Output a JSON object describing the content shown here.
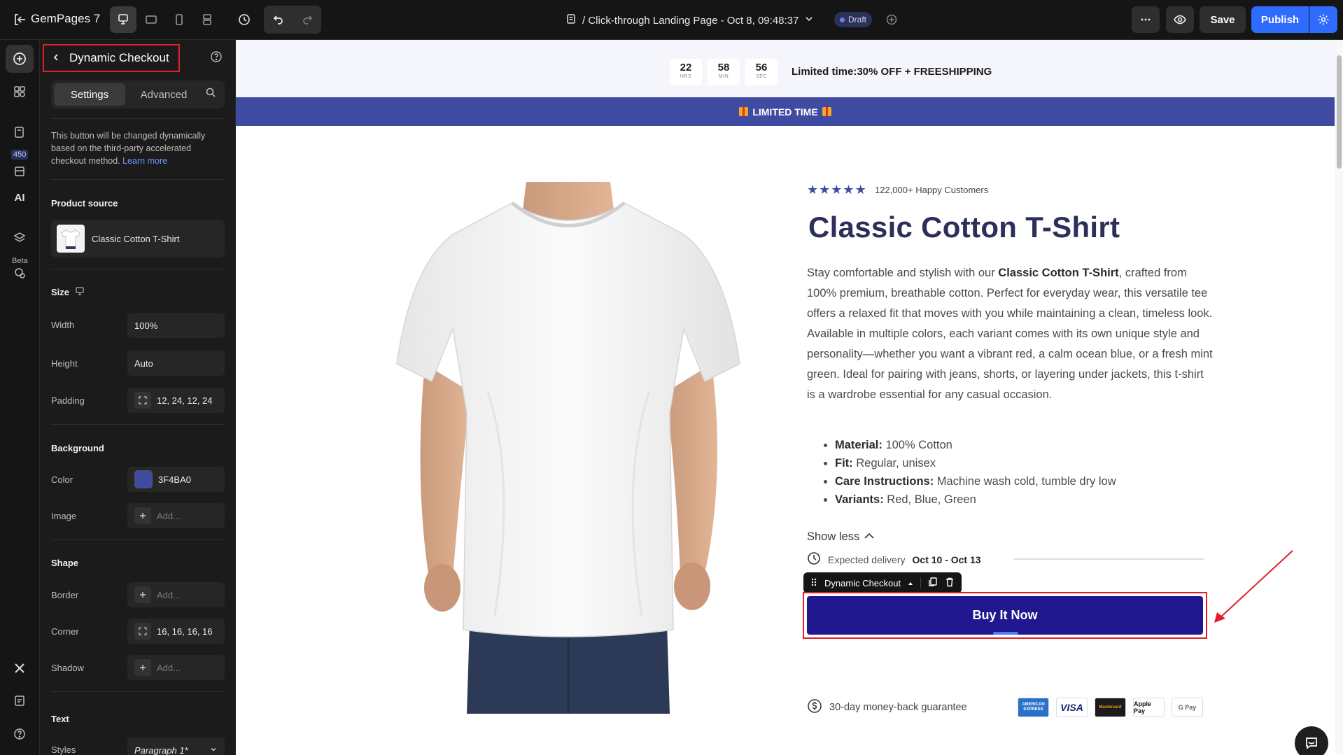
{
  "topbar": {
    "brand": "GemPages 7",
    "page_title": "/ Click-through Landing Page - Oct 8, 09:48:37",
    "status_badge": "Draft",
    "save_label": "Save",
    "publish_label": "Publish",
    "icons": [
      "exit-icon",
      "desktop-icon",
      "tablet-landscape-icon",
      "mobile-icon",
      "responsive-icon",
      "history-icon",
      "undo-icon",
      "redo-icon",
      "page-icon",
      "chevron-down-icon",
      "collaborate-icon",
      "more-icon",
      "preview-icon",
      "settings-icon"
    ]
  },
  "rail": {
    "badge_count": "450",
    "ai_label": "AI",
    "beta_label": "Beta"
  },
  "panel": {
    "title": "Dynamic Checkout",
    "tabs": [
      {
        "label": "Settings",
        "active": true
      },
      {
        "label": "Advanced",
        "active": false
      }
    ],
    "hint_text": "This button will be changed dynamically based on the third-party accelerated checkout method.",
    "hint_link": "Learn more",
    "product_source": {
      "title": "Product source",
      "product_name": "Classic Cotton T-Shirt"
    },
    "size": {
      "title": "Size",
      "width_label": "Width",
      "width_value": "100%",
      "height_label": "Height",
      "height_value": "Auto",
      "padding_label": "Padding",
      "padding_value": "12, 24, 12, 24"
    },
    "background": {
      "title": "Background",
      "color_label": "Color",
      "color_value": "3F4BA0",
      "color_hex": "#3F4BA0",
      "image_label": "Image",
      "image_placeholder": "Add..."
    },
    "shape": {
      "title": "Shape",
      "border_label": "Border",
      "border_placeholder": "Add...",
      "corner_label": "Corner",
      "corner_value": "16, 16, 16, 16",
      "shadow_label": "Shadow",
      "shadow_placeholder": "Add..."
    },
    "text": {
      "title": "Text",
      "styles_label": "Styles",
      "styles_value": "Paragraph 1*"
    }
  },
  "canvas": {
    "countdown": {
      "hours": "22",
      "hours_unit": "HRS",
      "minutes": "58",
      "minutes_unit": "MIN",
      "seconds": "56",
      "seconds_unit": "SEC",
      "promo": "Limited time:30% OFF + FREESHIPPING"
    },
    "banner": "LIMITED TIME",
    "product": {
      "rating_stars": 5,
      "reviews": "122,000+ Happy Customers",
      "title": "Classic Cotton T-Shirt",
      "desc_pre": "Stay comfortable and stylish with our ",
      "desc_bold": "Classic Cotton T-Shirt",
      "desc_post": ", crafted from 100% premium, breathable cotton. Perfect for everyday wear, this versatile tee offers a relaxed fit that moves with you while maintaining a clean, timeless look. Available in multiple colors, each variant comes with its own unique style and personality—whether you want a vibrant red, a calm ocean blue, or a fresh mint green. Ideal for pairing with jeans, shorts, or layering under jackets, this t-shirt is a wardrobe essential for any casual occasion.",
      "specs": [
        {
          "key": "Material:",
          "value": " 100% Cotton"
        },
        {
          "key": "Fit:",
          "value": " Regular, unisex"
        },
        {
          "key": "Care Instructions:",
          "value": " Machine wash cold, tumble dry low"
        },
        {
          "key": "Variants:",
          "value": " Red, Blue, Green"
        }
      ],
      "show_less": "Show less",
      "delivery_label": "Expected delivery",
      "delivery_dates": "Oct 10 - Oct 13",
      "element_toolbar_label": "Dynamic Checkout",
      "buy_button": "Buy It Now",
      "guarantee": "30-day money-back guarantee",
      "payments": [
        "AMERICAN EXPRESS",
        "VISA",
        "Mastercard",
        "Apple Pay",
        "G Pay"
      ]
    },
    "colors": {
      "accent": "#3F4BA0",
      "buy_button": "#21178f",
      "title": "#2c2f5a",
      "annotation": "#e0202a"
    }
  }
}
